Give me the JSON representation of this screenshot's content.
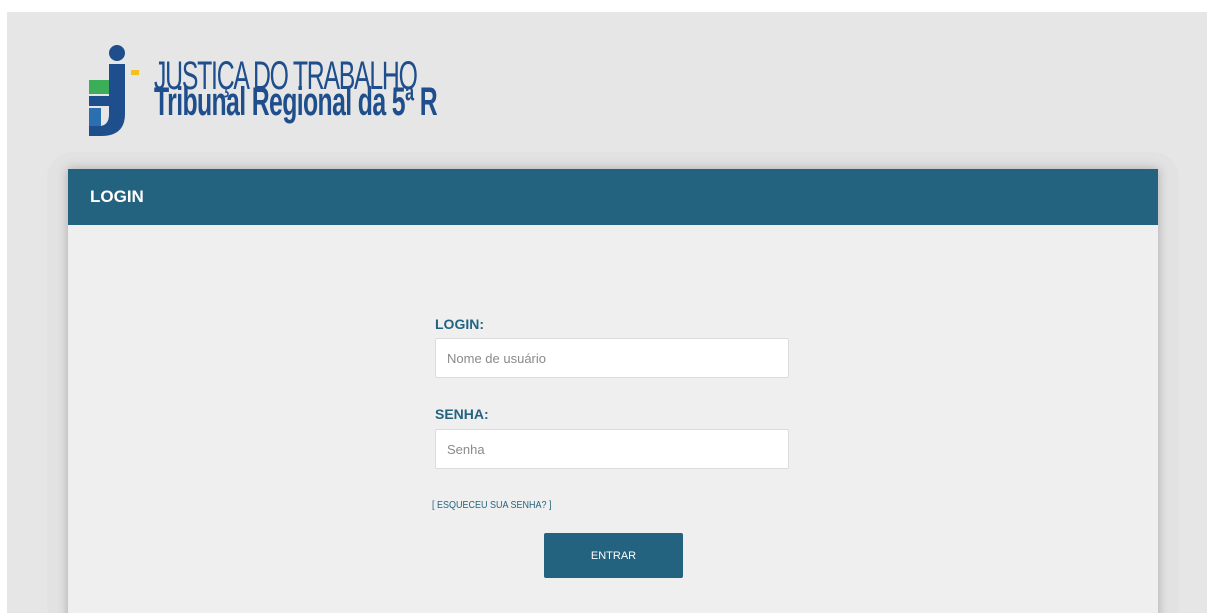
{
  "logo": {
    "line1": "JUSTIÇA DO TRABALHO",
    "line2": "Tribunal Regional da 5ª R"
  },
  "login_card": {
    "header_title": "LOGIN",
    "login_label": "LOGIN:",
    "login_placeholder": "Nome de usuário",
    "login_value": "",
    "password_label": "SENHA:",
    "password_placeholder": "Senha",
    "password_value": "",
    "forgot_password_link": "[ ESQUECEU SUA SENHA? ]",
    "submit_label": "ENTRAR"
  },
  "colors": {
    "primary": "#23637f",
    "logo_blue": "#1e4e8c",
    "logo_green": "#3cae5a",
    "logo_yellow": "#f3c21a",
    "background": "#e6e6e6"
  }
}
